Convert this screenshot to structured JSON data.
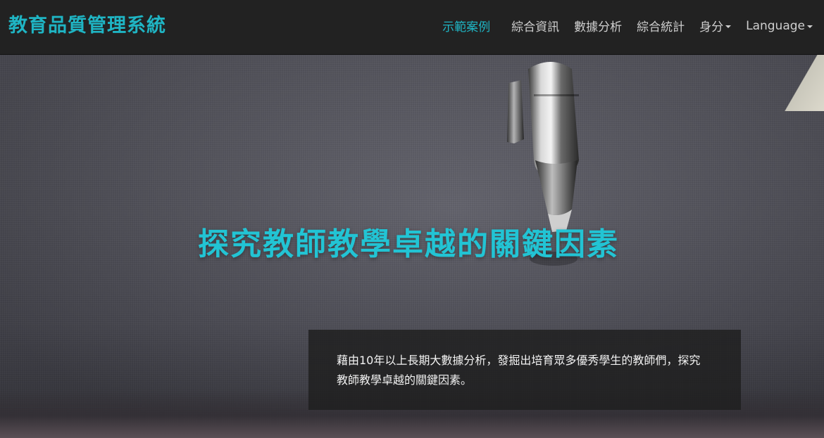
{
  "navbar": {
    "brand": "教育品質管理系統",
    "links": [
      {
        "label": "示範案例",
        "active": true,
        "dropdown": false
      },
      {
        "label": "綜合資訊",
        "active": false,
        "dropdown": false
      },
      {
        "label": "數據分析",
        "active": false,
        "dropdown": false
      },
      {
        "label": "綜合統計",
        "active": false,
        "dropdown": false
      },
      {
        "label": "身分",
        "active": false,
        "dropdown": true
      },
      {
        "label": "Language",
        "active": false,
        "dropdown": true
      }
    ]
  },
  "hero": {
    "title": "探究教師教學卓越的關鍵因素",
    "caption": "藉由10年以上長期大數據分析，發掘出培育眾多優秀學生的教師們，探究教師教學卓越的關鍵因素。"
  },
  "colors": {
    "accent": "#1fb5c4",
    "navbar_bg": "#222222",
    "nav_text": "#cfcfcf"
  }
}
